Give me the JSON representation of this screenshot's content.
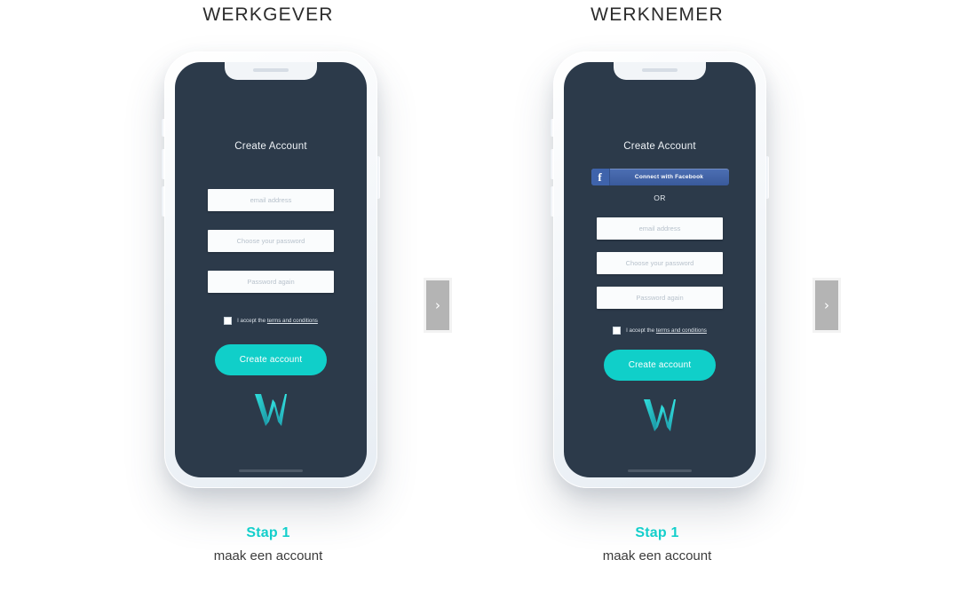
{
  "columns": [
    {
      "heading": "WERKGEVER",
      "variant": "a",
      "screen": {
        "title": "Create Account",
        "has_social": false,
        "fields": [
          {
            "placeholder": "email address",
            "name": "email-field"
          },
          {
            "placeholder": "Choose your password",
            "name": "password-field"
          },
          {
            "placeholder": "Password again",
            "name": "password-confirm-field"
          }
        ],
        "terms_prefix": "I accept the",
        "terms_link": "terms and conditions",
        "cta_label": "Create account",
        "logo": "w-logo"
      },
      "caption": {
        "step": "Stap 1",
        "sub": "maak een account"
      }
    },
    {
      "heading": "WERKNEMER",
      "variant": "b",
      "screen": {
        "title": "Create Account",
        "has_social": true,
        "facebook_label": "Connect with Facebook",
        "facebook_icon": "facebook-icon",
        "or_label": "OR",
        "fields": [
          {
            "placeholder": "email address",
            "name": "email-field"
          },
          {
            "placeholder": "Choose your password",
            "name": "password-field"
          },
          {
            "placeholder": "Password again",
            "name": "password-confirm-field"
          }
        ],
        "terms_prefix": "I accept the",
        "terms_link": "terms and conditions",
        "cta_label": "Create account",
        "logo": "w-logo"
      },
      "caption": {
        "step": "Stap 1",
        "sub": "maak een account"
      }
    }
  ],
  "arrows": {
    "next_glyph": "›"
  },
  "colors": {
    "accent_teal": "#10cfc9",
    "screen_bg": "#2c3a4a",
    "facebook_blue": "#3f63ab",
    "arrow_gray": "#b4b4b4"
  }
}
